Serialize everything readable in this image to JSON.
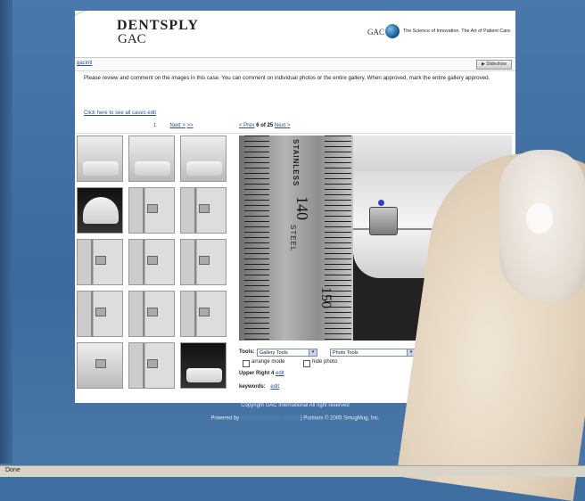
{
  "header": {
    "logo_line1": "DENTSPLY",
    "logo_line2": "GAC",
    "brand_small": "GAC",
    "tagline": "The Science of Innovation. The Art of Patient Care."
  },
  "nav": {
    "crumb": "gacintl",
    "slideshow_label": "▶ Slideshow"
  },
  "intro_text": "Please review and comment on the images in this case. You can comment on individual photos or the entire gallery. When approved, mark the entire gallery approved.",
  "see_all_link": "Click here to see all cases edit",
  "pager_left": {
    "current": "1",
    "next": "Next >",
    "last": ">>"
  },
  "pager_right": {
    "prev": "< Prev",
    "position": "6 of 25",
    "next": "Next >"
  },
  "main_image": {
    "ruler_word": "STAINLESS",
    "ruler_word2": "STEEL",
    "ruler_number": "140",
    "ruler_number2": "150"
  },
  "controls": {
    "tools_label": "Tools:",
    "gallery_tools": "Gallery Tools",
    "photo_tools": "Photo Tools",
    "arrange_mode": "arrange mode",
    "hide_photo": "hide photo",
    "caption": "Upper Right 4",
    "caption_edit": "edit",
    "keywords_label": "keywords:",
    "keywords_edit": "edit"
  },
  "footer": {
    "copyright": "Copyright GAC International All right reserved",
    "powered_by": "Powered by",
    "portions": "| Portions © 2005 SmugMug, Inc."
  },
  "status": {
    "text": "Done"
  }
}
